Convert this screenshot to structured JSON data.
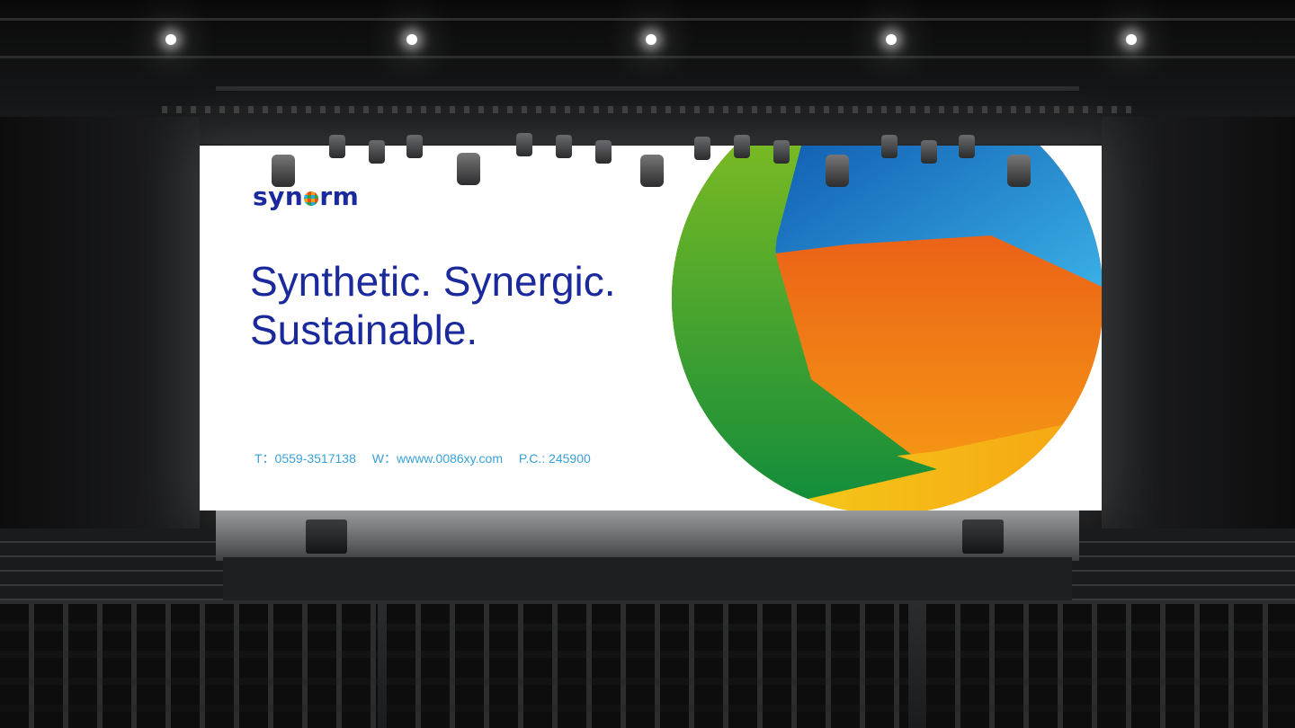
{
  "banner": {
    "logo_text_before": "syn",
    "logo_text_after": "rm",
    "tagline_line1": "Synthetic. Synergic.",
    "tagline_line2": "Sustainable.",
    "contact_phone": "T：0559-3517138",
    "contact_web": "W：wwww.0086xy.com",
    "contact_postcode": "P.C.: 245900"
  },
  "colors": {
    "brand_blue": "#1a2a9c",
    "contact_blue": "#3aa0d8",
    "ring_green": "#3a9e35",
    "ring_blue": "#2ba7e0",
    "ring_orange": "#e84e1b",
    "ring_yellow": "#f0a21a"
  },
  "icons": {
    "logo_mark": "multicolor-ring-o"
  }
}
